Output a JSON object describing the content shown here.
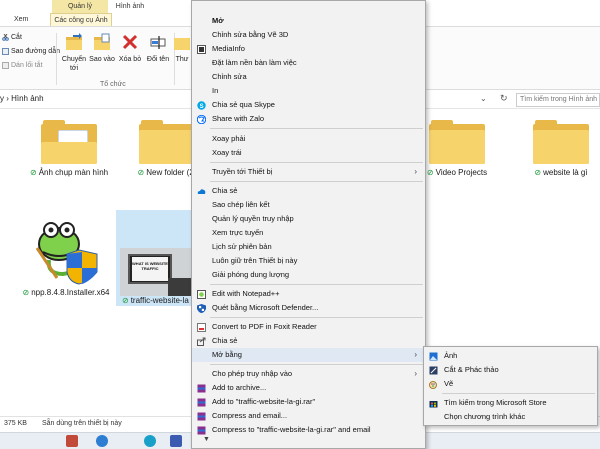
{
  "ribbon": {
    "tab_quanly": "Quản lý",
    "tab_hinhanh": "Hình ảnh",
    "tab_xem": "Xem",
    "tab_ccah": "Các công cụ Ảnh",
    "cut": "Cắt",
    "copy_path": "Sao đường dẫn",
    "paste_shortcut": "Dán lối tắt",
    "move_to": "Chuyển tới",
    "copy_to": "Sao vào",
    "delete": "Xóa bỏ",
    "rename": "Đổi tên",
    "new_folder": "Thư",
    "group_organize": "Tổ chức"
  },
  "address": {
    "path": "y › Hình ảnh",
    "search_placeholder": "Tìm kiếm trong Hình ảnh"
  },
  "files": [
    {
      "name": "Ảnh chụp màn hình"
    },
    {
      "name": "New folder (2)"
    },
    {
      "name": "Video Projects"
    },
    {
      "name": "website là gì"
    },
    {
      "name": "npp.8.4.8.Installer.x64"
    },
    {
      "name": "traffic-website-la"
    }
  ],
  "status": {
    "size": "375 KB",
    "availability": "Sẵn dùng trên thiết bị này"
  },
  "menu": [
    {
      "label": "Mở",
      "bold": true
    },
    {
      "label": "Chỉnh sửa bằng Vẽ 3D"
    },
    {
      "label": "MediaInfo"
    },
    {
      "label": "Đặt làm nền bàn làm việc"
    },
    {
      "label": "Chỉnh sửa"
    },
    {
      "label": "In"
    },
    {
      "label": "Chia sẻ qua Skype"
    },
    {
      "label": "Share with Zalo"
    },
    {
      "label": "Xoay phải"
    },
    {
      "label": "Xoay trái"
    },
    {
      "label": "Truyền tới Thiết bị"
    },
    {
      "label": "Chia sẻ"
    },
    {
      "label": "Sao chép liên kết"
    },
    {
      "label": "Quản lý quyền truy nhập"
    },
    {
      "label": "Xem trực tuyến"
    },
    {
      "label": "Lịch sử phiên bản"
    },
    {
      "label": "Luôn giữ trên Thiết bị này"
    },
    {
      "label": "Giải phóng dung lượng"
    },
    {
      "label": "Edit with Notepad++"
    },
    {
      "label": "Quét bằng Microsoft Defender..."
    },
    {
      "label": "Convert to PDF in Foxit Reader"
    },
    {
      "label": "Chia sẻ"
    },
    {
      "label": "Mở bằng"
    },
    {
      "label": "Cho phép truy nhập vào"
    },
    {
      "label": "Add to archive..."
    },
    {
      "label": "Add to \"traffic-website-la-gi.rar\""
    },
    {
      "label": "Compress and email..."
    },
    {
      "label": "Compress to \"traffic-website-la-gi.rar\" and email"
    }
  ],
  "submenu": [
    {
      "label": "Ảnh"
    },
    {
      "label": "Cắt & Phác thảo"
    },
    {
      "label": "Vẽ"
    },
    {
      "label": "Tìm kiếm trong Microsoft Store"
    },
    {
      "label": "Chọn chương trình khác"
    }
  ],
  "thumb_text": "WHAT IS WEBSITE TRAFFIC"
}
